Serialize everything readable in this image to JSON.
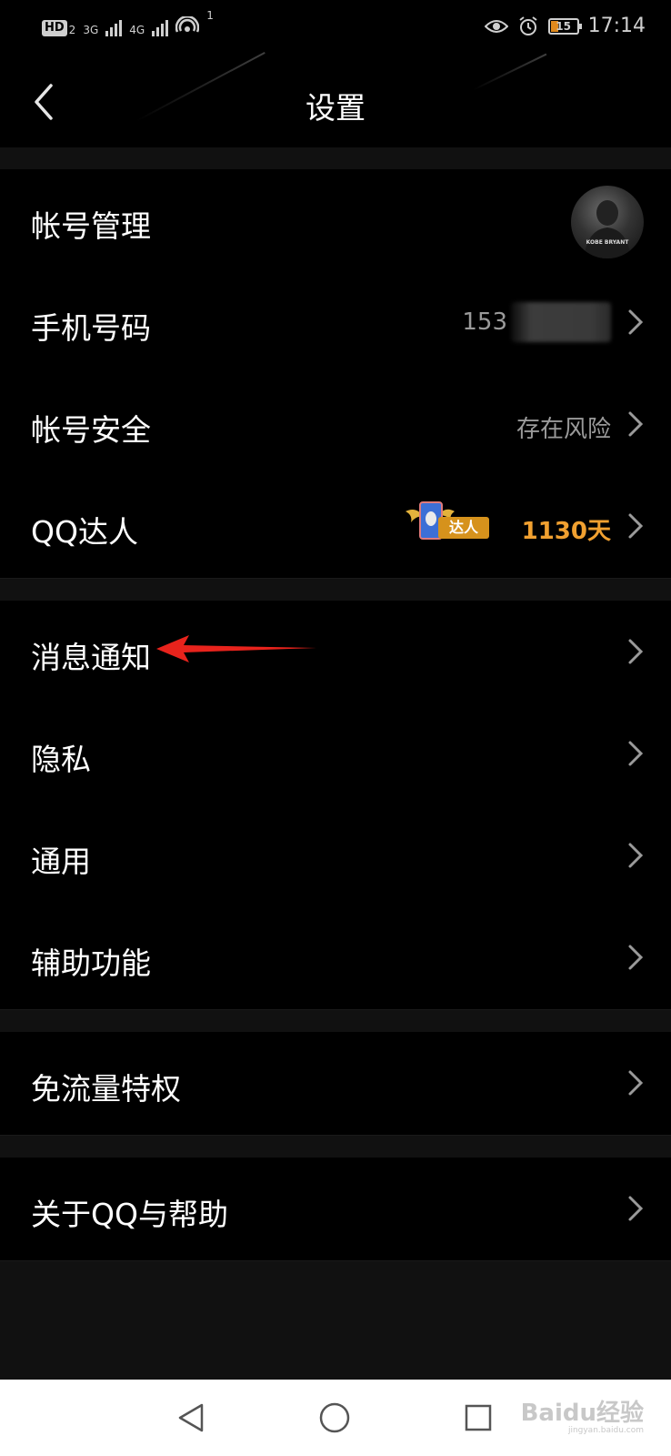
{
  "status_bar": {
    "hd": "HD",
    "sim2": "2",
    "net1": "3G",
    "net2": "4G",
    "hotspot_count": "1",
    "battery": "15",
    "time": "17:14"
  },
  "header": {
    "title": "设置"
  },
  "rows": [
    {
      "label": "帐号管理"
    },
    {
      "label": "手机号码",
      "value": "153"
    },
    {
      "label": "帐号安全",
      "value": "存在风险"
    },
    {
      "label": "QQ达人",
      "badge": "达人",
      "value": "1130天"
    },
    {
      "label": "消息通知"
    },
    {
      "label": "隐私"
    },
    {
      "label": "通用"
    },
    {
      "label": "辅助功能"
    },
    {
      "label": "免流量特权"
    },
    {
      "label": "关于QQ与帮助"
    }
  ],
  "avatar_caption": "KOBE BRYANT",
  "watermark": {
    "text": "Baidu经验",
    "sub": "jingyan.baidu.com"
  },
  "colors": {
    "accent_orange": "#f0a030",
    "arrow_red": "#e8231c",
    "background": "#000000",
    "navbar": "#ffffff"
  }
}
